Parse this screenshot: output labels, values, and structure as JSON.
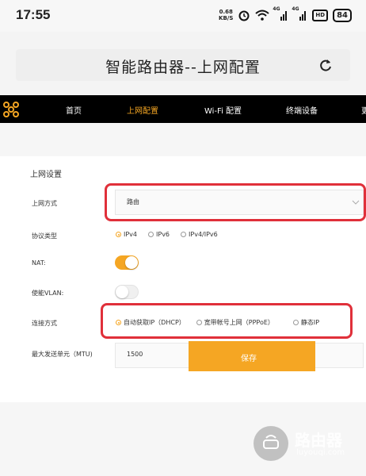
{
  "status_bar": {
    "time": "17:55",
    "net_speed_value": "0.68",
    "net_speed_unit": "KB/S",
    "signal1": "4G",
    "signal2": "4G",
    "hd": "HD",
    "battery": "84"
  },
  "browser": {
    "page_title": "智能路由器--上网配置"
  },
  "nav": {
    "items": [
      "首页",
      "上网配置",
      "Wi-Fi 配置",
      "终端设备",
      "更"
    ],
    "active_index": 1
  },
  "form": {
    "section_title": "上网设置",
    "access_mode": {
      "label": "上网方式",
      "value": "路由"
    },
    "protocol": {
      "label": "协议类型",
      "options": [
        "IPv4",
        "IPv6",
        "IPv4/IPv6"
      ],
      "selected": "IPv4"
    },
    "nat": {
      "label": "NAT:",
      "on": true
    },
    "vlan": {
      "label": "使能VLAN:",
      "on": false
    },
    "connection": {
      "label": "连接方式",
      "options": [
        "自动获取IP（DHCP）",
        "宽带帐号上网（PPPoE）",
        "静态IP"
      ],
      "selected": "自动获取IP（DHCP）"
    },
    "mtu": {
      "label": "最大发送单元（MTU)",
      "value": "1500"
    }
  },
  "save_button_label": "保存",
  "watermark": {
    "text": "路由器",
    "subtext": "luyouqi.com"
  },
  "colors": {
    "accent": "#f5a623",
    "highlight": "#e0303a",
    "navbar": "#000000"
  }
}
